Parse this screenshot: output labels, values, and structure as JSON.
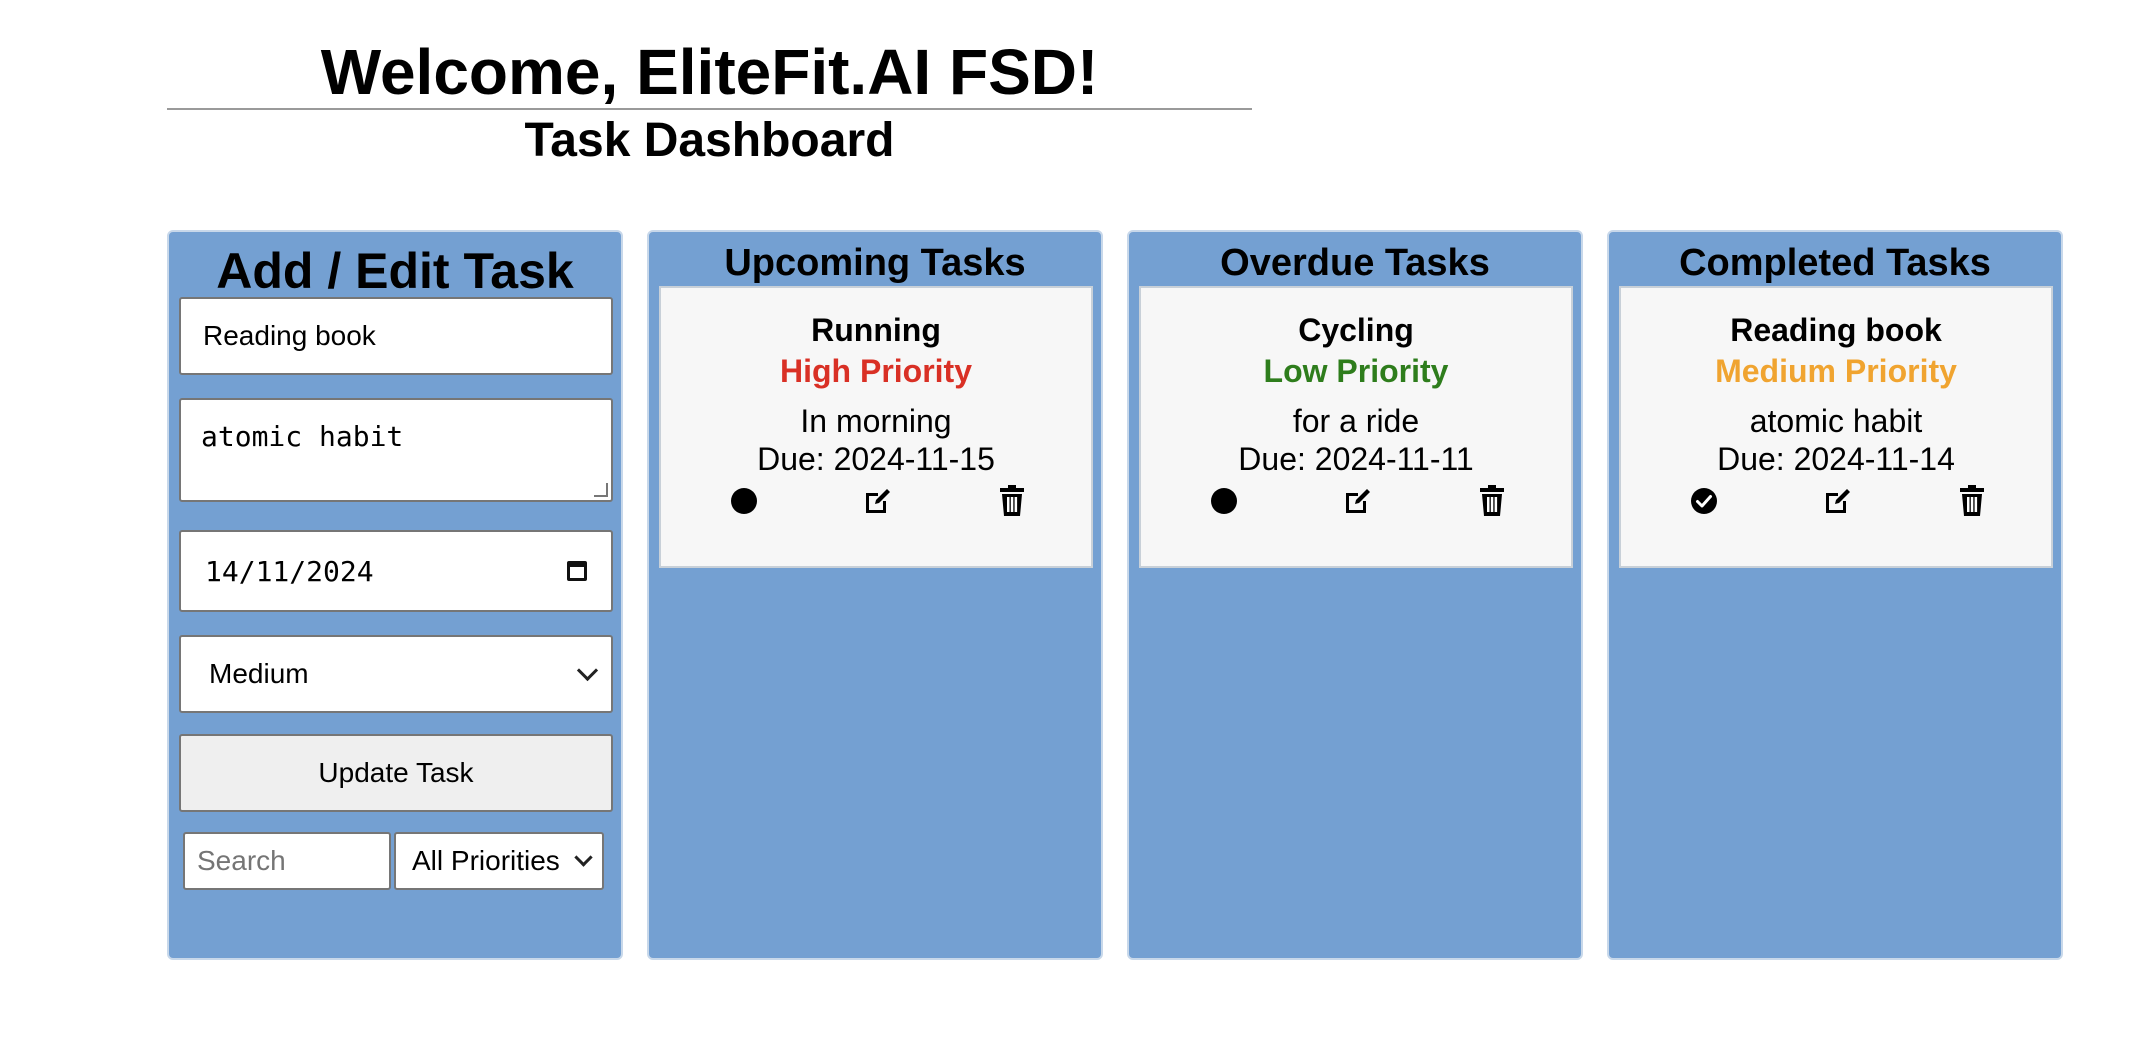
{
  "header": {
    "welcome": "Welcome, EliteFit.AI FSD!",
    "subtitle": "Task Dashboard"
  },
  "form": {
    "title": "Add / Edit Task",
    "title_value": "Reading book",
    "description_value": "atomic habit",
    "date_value": "14/11/2024",
    "priority_value": "Medium",
    "submit_label": "Update Task",
    "search_placeholder": "Search",
    "filter_value": "All Priorities"
  },
  "columns": {
    "upcoming": {
      "title": "Upcoming Tasks",
      "task": {
        "title": "Running",
        "priority": "High Priority",
        "priority_color": "#d93025",
        "description": "In morning",
        "due": "Due: 2024-11-15",
        "status_icon": "circle-icon"
      }
    },
    "overdue": {
      "title": "Overdue Tasks",
      "task": {
        "title": "Cycling",
        "priority": "Low Priority",
        "priority_color": "#2e7d1c",
        "description": "for a ride",
        "due": "Due: 2024-11-11",
        "status_icon": "circle-icon"
      }
    },
    "completed": {
      "title": "Completed Tasks",
      "task": {
        "title": "Reading book",
        "priority": "Medium Priority",
        "priority_color": "#f0a430",
        "description": "atomic habit",
        "due": "Due: 2024-11-14",
        "status_icon": "check-circle-icon"
      }
    }
  },
  "colors": {
    "panel_bg": "#74a0d2",
    "card_bg": "#f7f7f7"
  }
}
